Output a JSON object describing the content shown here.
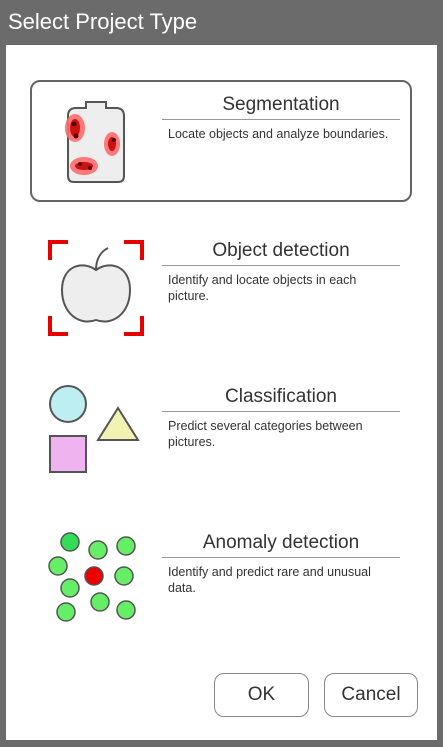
{
  "window": {
    "title": "Select Project Type"
  },
  "options": [
    {
      "id": "segmentation",
      "title": "Segmentation",
      "description": "Locate objects and analyze boundaries.",
      "icon": "segmentation-icon",
      "selected": true
    },
    {
      "id": "object-detection",
      "title": "Object detection",
      "description": "Identify and locate objects in each picture.",
      "icon": "object-detection-icon",
      "selected": false
    },
    {
      "id": "classification",
      "title": "Classification",
      "description": "Predict several categories between pictures.",
      "icon": "classification-icon",
      "selected": false
    },
    {
      "id": "anomaly-detection",
      "title": "Anomaly detection",
      "description": "Identify and predict rare and unusual data.",
      "icon": "anomaly-detection-icon",
      "selected": false
    }
  ],
  "buttons": {
    "ok": "OK",
    "cancel": "Cancel"
  },
  "colors": {
    "titlebar": "#6b6b6b",
    "accent_red": "#e60000",
    "circle_cyan": "#bdeef2",
    "triangle_yellow": "#f2f2b3",
    "square_pink": "#efb3ef",
    "dot_green": "#66ee66",
    "dot_red": "#ee0000"
  }
}
